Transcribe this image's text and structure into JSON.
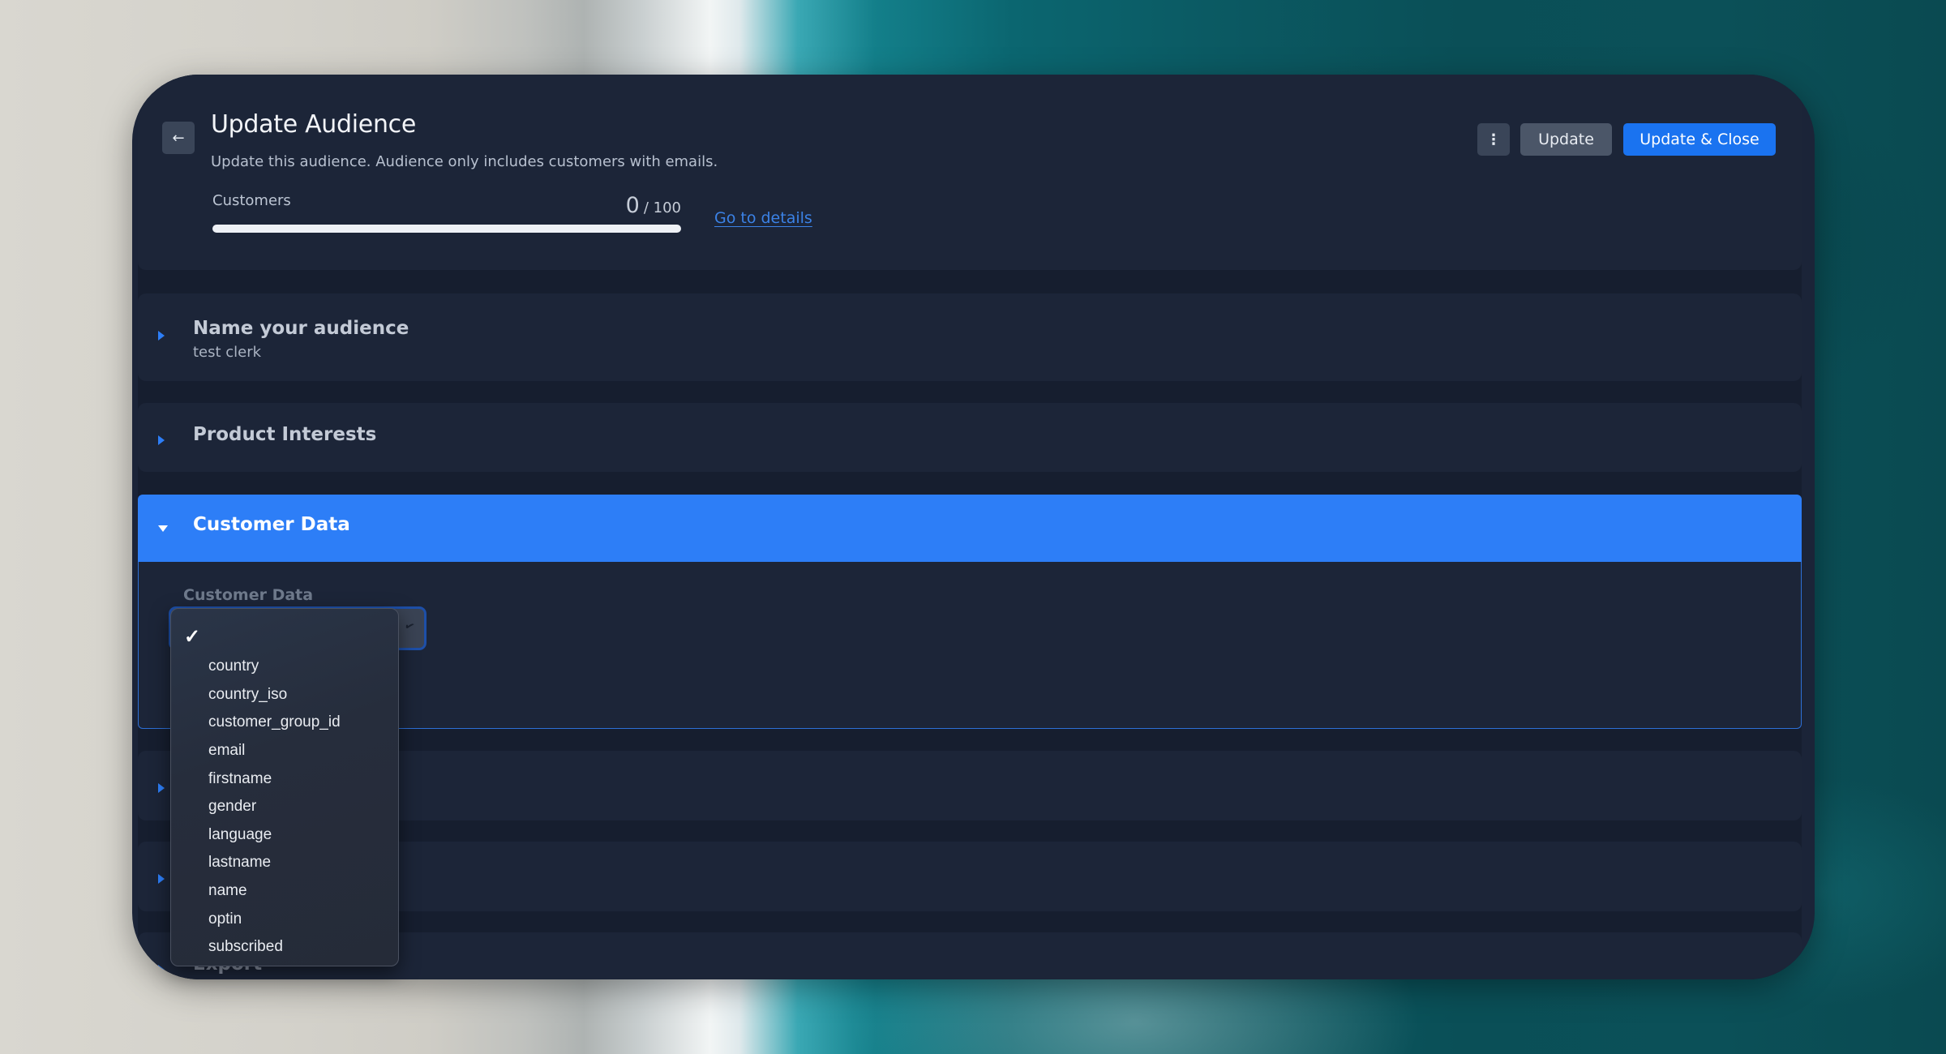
{
  "header": {
    "back_icon": "arrow-left-icon",
    "title": "Update Audience",
    "subtitle": "Update this audience. Audience only includes customers with emails.",
    "customers": {
      "label": "Customers",
      "count": "0",
      "total": "/ 100",
      "progress_percent": 0
    },
    "details_link": "Go to details",
    "buttons": {
      "more_icon": "vertical-ellipsis-icon",
      "update": "Update",
      "update_close": "Update & Close"
    }
  },
  "sections": [
    {
      "title": "Name your audience",
      "subtitle": "test clerk",
      "expanded": false
    },
    {
      "title": "Product Interests",
      "subtitle": "",
      "expanded": false
    },
    {
      "title": "Customer Data",
      "expanded": true,
      "field_label": "Customer Data",
      "select_value": ""
    },
    {
      "title": "",
      "expanded": false
    },
    {
      "title": "",
      "expanded": false
    },
    {
      "title": "Export",
      "expanded": false
    }
  ],
  "dropdown": {
    "selected_index": 0,
    "options": [
      "",
      "country",
      "country_iso",
      "customer_group_id",
      "email",
      "firstname",
      "gender",
      "language",
      "lastname",
      "name",
      "optin",
      "subscribed"
    ]
  },
  "colors": {
    "accent": "#2d7ef7",
    "primary_button": "#1a73f0",
    "card_bg": "#1b2438",
    "panel_bg": "#1c2538",
    "link": "#3b82e6"
  }
}
